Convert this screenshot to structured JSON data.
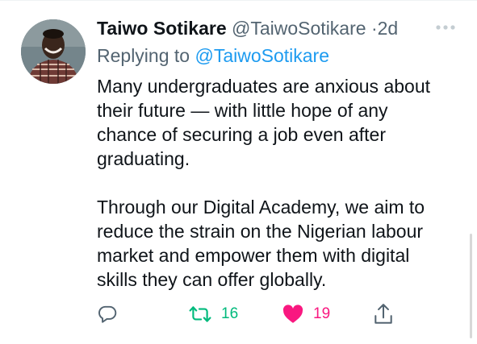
{
  "tweet": {
    "author_name": "Taiwo Sotikare",
    "author_handle": "@TaiwoSotikare",
    "separator": "·",
    "time": "2d",
    "replying_prefix": "Replying to ",
    "replying_handle": "@TaiwoSotikare",
    "paragraph_1": "Many undergraduates are anxious about their future — with little hope of any chance of securing a job even after graduating.",
    "paragraph_2": "Through our Digital Academy, we aim to reduce the strain on the Nigerian labour market and empower them with digital skills they can offer globally."
  },
  "actions": {
    "reply_icon": "reply-icon",
    "retweet_icon": "retweet-icon",
    "retweet_count": "16",
    "like_icon": "heart-icon",
    "like_count": "19",
    "like_active": true,
    "share_icon": "share-icon"
  },
  "colors": {
    "text": "#0f1419",
    "muted": "#536471",
    "link": "#1d9bf0",
    "retweet": "#00ba7c",
    "like": "#f91880"
  }
}
